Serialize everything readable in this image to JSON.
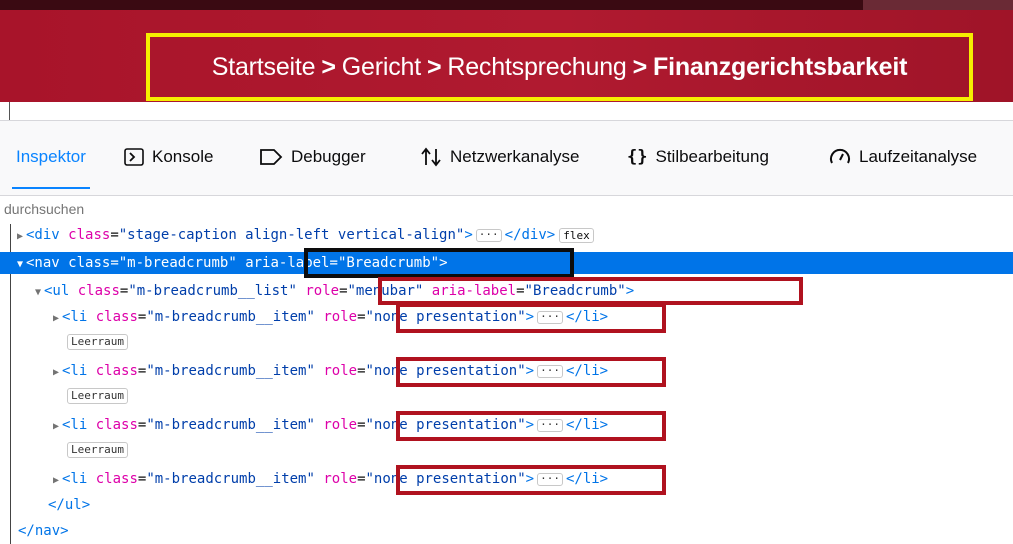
{
  "banner": {
    "breadcrumb": [
      "Startseite",
      "Gericht",
      "Rechtsprechung"
    ],
    "current": "Finanzgerichtsbarkeit",
    "separator": ">"
  },
  "devtools": {
    "tabs": [
      {
        "label": "Inspektor",
        "icon": "inspector-icon"
      },
      {
        "label": "Konsole",
        "icon": "console-icon"
      },
      {
        "label": "Debugger",
        "icon": "debugger-icon"
      },
      {
        "label": "Netzwerkanalyse",
        "icon": "network-icon"
      },
      {
        "label": "Stilbearbeitung",
        "icon": "style-editor-icon"
      },
      {
        "label": "Laufzeitanalyse",
        "icon": "performance-icon"
      }
    ],
    "active_tab": "Inspektor",
    "search_placeholder": "durchsuchen"
  },
  "markup": {
    "div_line": {
      "tag": "<div",
      "attr": "class",
      "value": "\"stage-caption align-left vertical-align\"",
      "close": ">",
      "end": "</div>",
      "badge": "flex"
    },
    "nav_line": {
      "tag": "<nav",
      "attr1": "class",
      "val1": "\"m-breadcrumb\"",
      "attr2": "aria-label",
      "val2": "\"Breadcrumb\"",
      "close": ">"
    },
    "ul_line": {
      "tag": "<ul",
      "attr1": "class",
      "val1": "\"m-breadcrumb__list\"",
      "attr2": "role",
      "val2": "\"menubar\"",
      "attr3": "aria-label",
      "val3": "\"Breadcrumb\"",
      "close": ">"
    },
    "li_items": [
      {
        "tag": "<li",
        "attr1": "class",
        "val1": "\"m-breadcrumb__item\"",
        "attr2": "role",
        "val2": "\"none presentation\"",
        "end": "</li>",
        "whitespace": "Leerraum"
      },
      {
        "tag": "<li",
        "attr1": "class",
        "val1": "\"m-breadcrumb__item\"",
        "attr2": "role",
        "val2": "\"none presentation\"",
        "end": "</li>",
        "whitespace": "Leerraum"
      },
      {
        "tag": "<li",
        "attr1": "class",
        "val1": "\"m-breadcrumb__item\"",
        "attr2": "role",
        "val2": "\"none presentation\"",
        "end": "</li>",
        "whitespace": "Leerraum"
      },
      {
        "tag": "<li",
        "attr1": "class",
        "val1": "\"m-breadcrumb__item\"",
        "attr2": "role",
        "val2": "\"none presentation\"",
        "end": "</li>",
        "whitespace": ""
      }
    ],
    "ul_close": "</ul>",
    "nav_close": "</nav>"
  },
  "colors": {
    "banner_red": "#b01a30",
    "highlight_yellow": "#f5ee00",
    "annotation_red": "#b0121f",
    "annotation_black": "#0c0c0d",
    "selection_blue": "#0074e8"
  }
}
